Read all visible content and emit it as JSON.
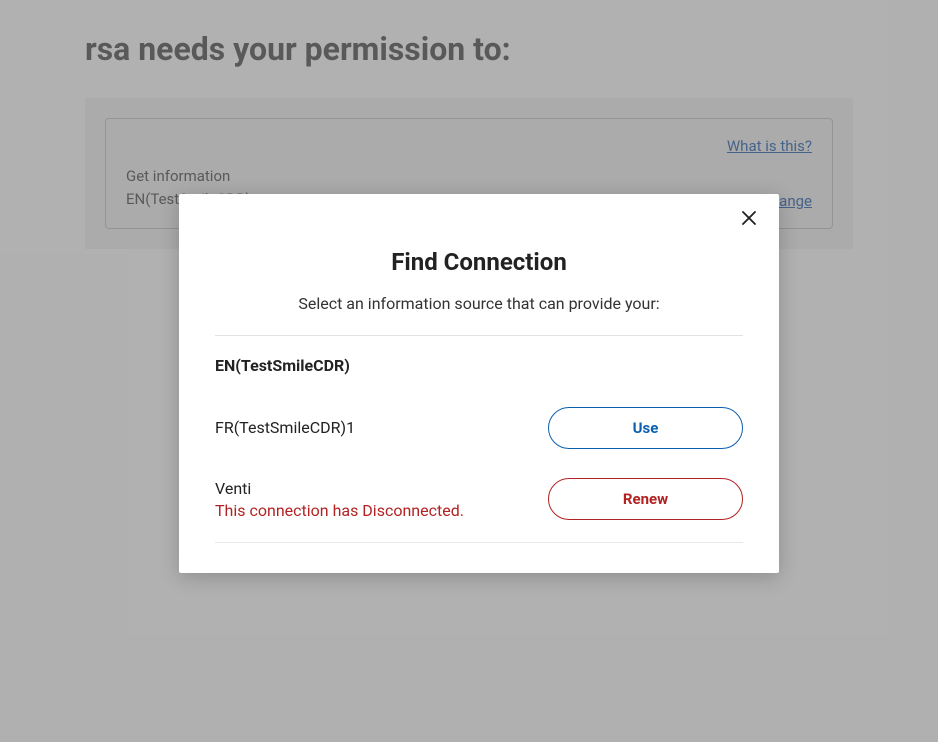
{
  "page": {
    "title": "rsa needs your permission to:"
  },
  "card": {
    "what_link": "What is this?",
    "info_line1": "Get information",
    "info_line2": "EN(TestSmileCDR)",
    "change_link": "Change"
  },
  "modal": {
    "title": "Find Connection",
    "subtitle": "Select an information source that can provide your:",
    "group_heading": "EN(TestSmileCDR)",
    "rows": [
      {
        "name": "FR(TestSmileCDR)1",
        "error": "",
        "button": "Use",
        "variant": "blue"
      },
      {
        "name": "Venti",
        "error": "This connection has Disconnected.",
        "button": "Renew",
        "variant": "red"
      }
    ]
  }
}
